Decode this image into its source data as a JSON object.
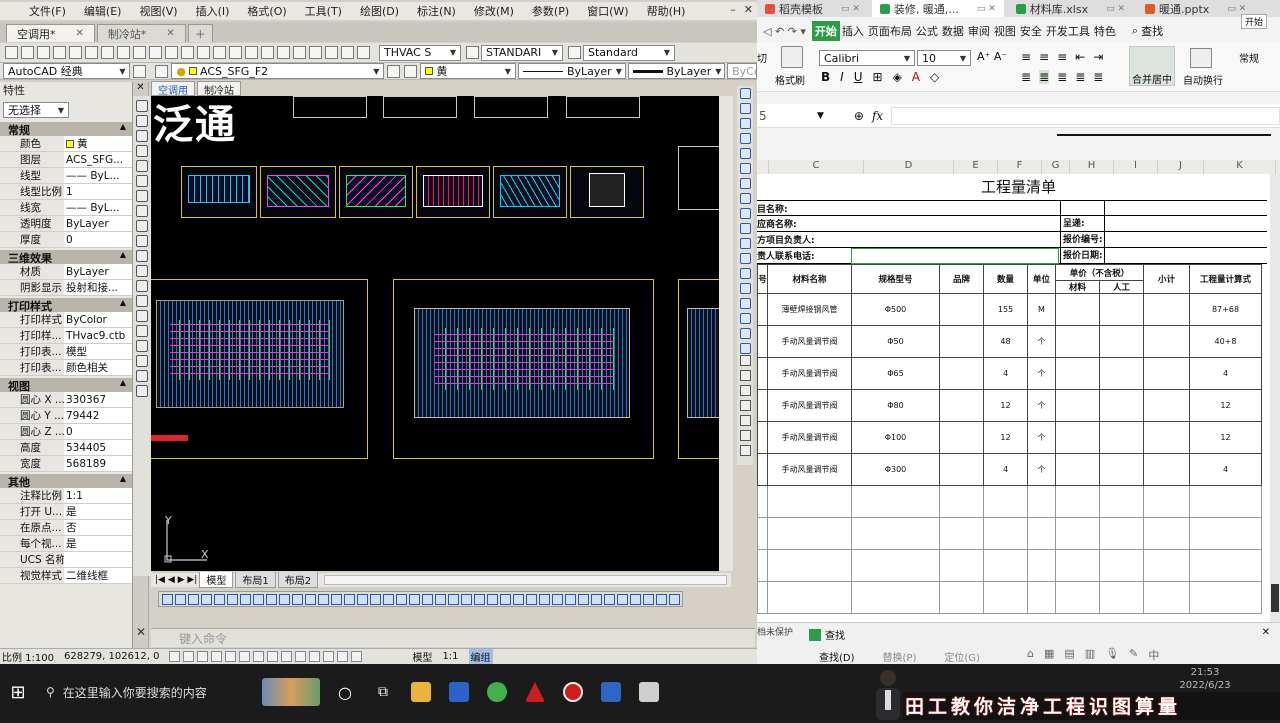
{
  "cad": {
    "menu": [
      "文件(F)",
      "编辑(E)",
      "视图(V)",
      "插入(I)",
      "格式(O)",
      "工具(T)",
      "绘图(D)",
      "标注(N)",
      "修改(M)",
      "参数(P)",
      "窗口(W)",
      "帮助(H)"
    ],
    "file_tabs": [
      {
        "label": "空调用*",
        "active": true
      },
      {
        "label": "制冷站*",
        "active": false
      }
    ],
    "toolbar": {
      "textstyle": "THVAC S",
      "dimstyle": "STANDARI",
      "tablestyle": "Standard"
    },
    "workspace": "AutoCAD 经典",
    "layer": "ACS_SFG_F2",
    "color_combo": "黄",
    "linetype_combo": "ByLayer",
    "lineweight_combo": "ByLayer",
    "plotstyle_combo": "ByCo",
    "viewport_tabs": [
      "空调用",
      "制冷站"
    ],
    "props": {
      "title": "特性",
      "selection": "无选择",
      "groups": [
        {
          "name": "常规",
          "rows": [
            [
              "颜色",
              "黄"
            ],
            [
              "图层",
              "ACS_SFG..."
            ],
            [
              "线型",
              "—— ByL..."
            ],
            [
              "线型比例",
              "1"
            ],
            [
              "线宽",
              "—— ByL..."
            ],
            [
              "透明度",
              "ByLayer"
            ],
            [
              "厚度",
              "0"
            ]
          ]
        },
        {
          "name": "三维效果",
          "rows": [
            [
              "材质",
              "ByLayer"
            ],
            [
              "阴影显示",
              "投射和接..."
            ]
          ]
        },
        {
          "name": "打印样式",
          "rows": [
            [
              "打印样式",
              "ByColor"
            ],
            [
              "打印样...",
              "THvac9.ctb"
            ],
            [
              "打印表...",
              "模型"
            ],
            [
              "打印表...",
              "颜色相关"
            ]
          ]
        },
        {
          "name": "视图",
          "rows": [
            [
              "圆心 X ...",
              "330367"
            ],
            [
              "圆心 Y ...",
              "79442"
            ],
            [
              "圆心 Z ...",
              "0"
            ],
            [
              "高度",
              "534405"
            ],
            [
              "宽度",
              "568189"
            ]
          ]
        },
        {
          "name": "其他",
          "rows": [
            [
              "注释比例",
              "1:1"
            ],
            [
              "打开 U...",
              "是"
            ],
            [
              "在原点...",
              "否"
            ],
            [
              "每个视...",
              "是"
            ],
            [
              "UCS 名称",
              ""
            ],
            [
              "视觉样式",
              "二维线框"
            ]
          ]
        }
      ]
    },
    "canvas_title": "泛通",
    "ucs_x": "X",
    "ucs_y": "Y",
    "layout_tabs": [
      "模型",
      "布局1",
      "布局2"
    ],
    "command_placeholder": "键入命令",
    "status": {
      "scale": "比例 1:100",
      "coords": "628279, 102612, 0",
      "model": "模型",
      "annot_scale": "1:1",
      "mode": "编组"
    }
  },
  "wps": {
    "tabs": [
      {
        "label": "稻壳模板",
        "color": "#e94b3c",
        "active": false
      },
      {
        "label": "装修, 暖通,...",
        "color": "#2a9d47",
        "active": true
      },
      {
        "label": "材料库.xlsx",
        "color": "#2a9d47",
        "active": false
      },
      {
        "label": "暖通.pptx",
        "color": "#e05a2a",
        "active": false
      }
    ],
    "tooltip": "开始",
    "ribbon_tabs": [
      "开始",
      "插入",
      "页面布局",
      "公式",
      "数据",
      "审阅",
      "视图",
      "安全",
      "开发工具",
      "特色"
    ],
    "ribbon_search": "查找",
    "font_name": "Calibri",
    "font_size": "10",
    "ribbon_labels": {
      "format_painter": "格式刷",
      "cut": "切",
      "merge": "合并居中",
      "wrap": "自动换行",
      "style": "常规"
    },
    "name_box": "5",
    "fx": "fx",
    "columns": [
      {
        "id": "C",
        "w": 95
      },
      {
        "id": "D",
        "w": 90
      },
      {
        "id": "E",
        "w": 44
      },
      {
        "id": "F",
        "w": 44
      },
      {
        "id": "G",
        "w": 28
      },
      {
        "id": "H",
        "w": 44
      },
      {
        "id": "I",
        "w": 44
      },
      {
        "id": "J",
        "w": 46
      },
      {
        "id": "K",
        "w": 72
      }
    ],
    "sheet_title": "工程量清单",
    "form_rows": [
      {
        "left": "目名称:",
        "right": "",
        "right_val": ""
      },
      {
        "left": "应商名称:",
        "right": "呈递:"
      },
      {
        "left": "方项目负责人:",
        "right": "报价编号:"
      },
      {
        "left": "责人联系电话:",
        "right": "报价日期:"
      }
    ],
    "table": {
      "headers": [
        "号",
        "材料名称",
        "规格型号",
        "品牌",
        "数量",
        "单位",
        "单价（不含税）",
        "小计",
        "工程量计算式"
      ],
      "subheaders": [
        "材料",
        "人工"
      ],
      "rows": [
        [
          "",
          "薄壁焊接钢风管",
          "Φ500",
          "",
          "155",
          "M",
          "",
          "",
          "",
          "87+68"
        ],
        [
          "",
          "手动风量调节阀",
          "Φ50",
          "",
          "48",
          "个",
          "",
          "",
          "",
          "40+8"
        ],
        [
          "",
          "手动风量调节阀",
          "Φ65",
          "",
          "4",
          "个",
          "",
          "",
          "",
          "4"
        ],
        [
          "",
          "手动风量调节阀",
          "Φ80",
          "",
          "12",
          "个",
          "",
          "",
          "",
          "12"
        ],
        [
          "",
          "手动风量调节阀",
          "Φ100",
          "",
          "12",
          "个",
          "",
          "",
          "",
          "12"
        ],
        [
          "",
          "手动风量调节阀",
          "Φ300",
          "",
          "4",
          "个",
          "",
          "",
          "",
          "4"
        ]
      ]
    },
    "find": {
      "title": "查找",
      "find_btn": "查找(D)",
      "other": "替换(P)",
      "goto": "定位(G)",
      "protect": "档未保护"
    }
  },
  "taskbar": {
    "search_placeholder": "在这里输入你要搜索的内容",
    "time": "21:53",
    "date": "2022/6/23",
    "banner": "田工教你洁净工程识图算量"
  },
  "colors": {
    "wps_green": "#2a9d47",
    "cad_yellow": "#d4c440",
    "canvas": "#000000"
  }
}
